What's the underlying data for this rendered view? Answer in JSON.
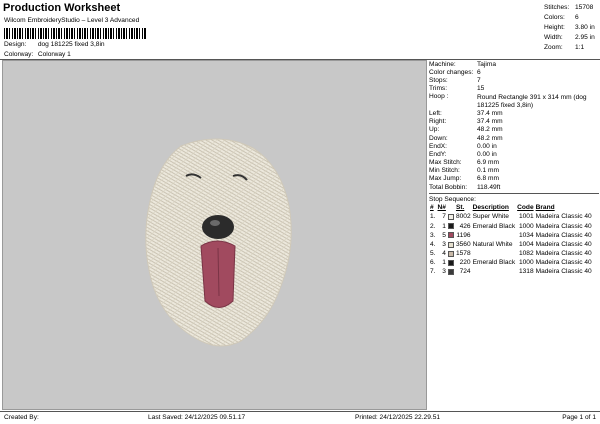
{
  "header": {
    "title": "Production Worksheet",
    "subtitle": "Wilcom EmbroideryStudio – Level 3 Advanced",
    "design_label": "Design:",
    "design_value": "dog 181225 fixed 3,8in",
    "colorway_label": "Colorway:",
    "colorway_value": "Colorway 1"
  },
  "stats": [
    {
      "label": "Stitches:",
      "value": "15708"
    },
    {
      "label": "Colors:",
      "value": "6"
    },
    {
      "label": "Height:",
      "value": "3.80 in"
    },
    {
      "label": "Width:",
      "value": "2.95 in"
    },
    {
      "label": "Zoom:",
      "value": "1:1"
    }
  ],
  "info": [
    {
      "label": "Machine:",
      "value": "Tajima"
    },
    {
      "label": "Color changes:",
      "value": "6"
    },
    {
      "label": "Stops:",
      "value": "7"
    },
    {
      "label": "Trims:",
      "value": "15"
    },
    {
      "label": "Hoop :",
      "value": "Round Rectangle 391 x 314 mm (dog 181225 fixed 3,8in)",
      "wrap": true
    },
    {
      "label": "Left:",
      "value": "37.4 mm"
    },
    {
      "label": "Right:",
      "value": "37.4 mm"
    },
    {
      "label": "Up:",
      "value": "48.2 mm"
    },
    {
      "label": "Down:",
      "value": "48.2 mm"
    },
    {
      "label": "EndX:",
      "value": "0.00 in"
    },
    {
      "label": "EndY:",
      "value": "0.00 in"
    },
    {
      "label": "Max Stitch:",
      "value": "6.9 mm"
    },
    {
      "label": "Min Stitch:",
      "value": "0.1 mm"
    },
    {
      "label": "Max Jump:",
      "value": "6.8 mm"
    },
    {
      "label": "Total Bobbin:",
      "value": "118.49ft"
    }
  ],
  "sequence": {
    "title": "Stop Sequence:",
    "headers": [
      "#",
      "N#",
      "",
      "St.",
      "Description",
      "Code",
      "Brand"
    ],
    "rows": [
      {
        "idx": "1.",
        "n": "7",
        "color": "#f2efe6",
        "st": "8002",
        "desc": "Super White",
        "code": "1001",
        "brand": "Madeira Classic 40"
      },
      {
        "idx": "2.",
        "n": "1",
        "color": "#1a1a1a",
        "st": "426",
        "desc": "Emerald Black",
        "code": "1000",
        "brand": "Madeira Classic 40"
      },
      {
        "idx": "3.",
        "n": "5",
        "color": "#a14a5f",
        "st": "1196",
        "desc": "",
        "code": "1034",
        "brand": "Madeira Classic 40"
      },
      {
        "idx": "4.",
        "n": "3",
        "color": "#e6e0cf",
        "st": "3560",
        "desc": "Natural White",
        "code": "1004",
        "brand": "Madeira Classic 40"
      },
      {
        "idx": "5.",
        "n": "4",
        "color": "#c9b9a8",
        "st": "1578",
        "desc": "",
        "code": "1082",
        "brand": "Madeira Classic 40"
      },
      {
        "idx": "6.",
        "n": "1",
        "color": "#1a1a1a",
        "st": "220",
        "desc": "Emerald Black",
        "code": "1000",
        "brand": "Madeira Classic 40"
      },
      {
        "idx": "7.",
        "n": "3",
        "color": "#3a3a3a",
        "st": "724",
        "desc": "",
        "code": "1318",
        "brand": "Madeira Classic 40"
      }
    ]
  },
  "footer": {
    "created_by": "Created By:",
    "last_saved": "Last Saved: 24/12/2025 09.51.17",
    "printed": "Printed: 24/12/2025 22.29.51",
    "page": "Page 1 of 1"
  },
  "colors": {
    "canvas_bg": "#c8c8c8",
    "fur": "#f2efe6",
    "tongue": "#a14a5f",
    "nose": "#2b2b2b"
  }
}
